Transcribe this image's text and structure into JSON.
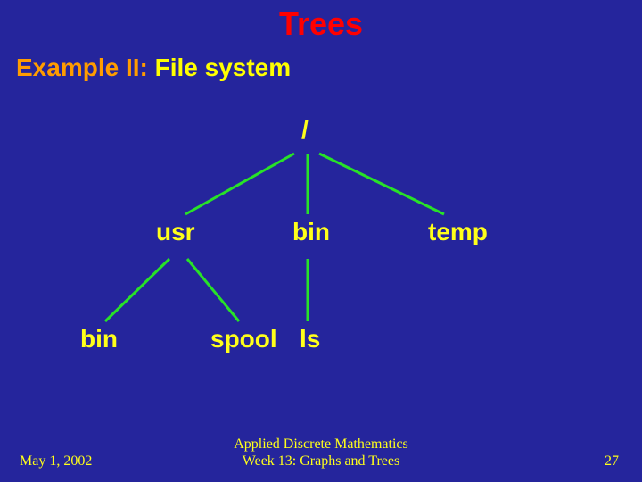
{
  "title": "Trees",
  "subtitle_lead": "Example II:",
  "subtitle_rest": " File system",
  "nodes": {
    "root": "/",
    "usr": "usr",
    "bin_top": "bin",
    "temp": "temp",
    "bin_leaf": "bin",
    "spool": "spool",
    "ls": "ls"
  },
  "footer": {
    "date": "May 1, 2002",
    "line1": "Applied Discrete Mathematics",
    "line2": "Week 13: Graphs and Trees",
    "page": "27"
  }
}
